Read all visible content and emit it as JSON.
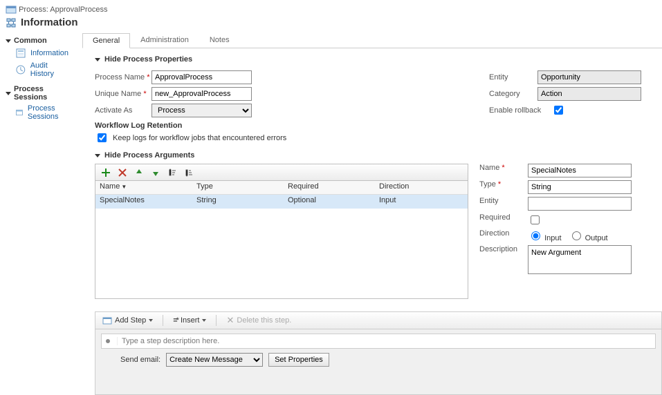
{
  "header": {
    "process_label": "Process: ApprovalProcess",
    "title": "Information"
  },
  "nav": {
    "common": {
      "label": "Common",
      "items": [
        {
          "label": "Information",
          "icon": "form-icon"
        },
        {
          "label": "Audit History",
          "icon": "history-icon"
        }
      ]
    },
    "sessions": {
      "label": "Process Sessions",
      "items": [
        {
          "label": "Process Sessions",
          "icon": "sessions-icon"
        }
      ]
    }
  },
  "tabs": {
    "general": "General",
    "administration": "Administration",
    "notes": "Notes"
  },
  "sections": {
    "properties": "Hide Process Properties",
    "arguments": "Hide Process Arguments"
  },
  "form": {
    "process_name": {
      "label": "Process Name",
      "value": "ApprovalProcess"
    },
    "unique_name": {
      "label": "Unique Name",
      "value": "new_ApprovalProcess"
    },
    "activate_as": {
      "label": "Activate As",
      "value": "Process"
    },
    "entity": {
      "label": "Entity",
      "value": "Opportunity"
    },
    "category": {
      "label": "Category",
      "value": "Action"
    },
    "enable_rollback": {
      "label": "Enable rollback",
      "checked": true
    },
    "wf_heading": "Workflow Log Retention",
    "wf_checkbox": {
      "label": "Keep logs for workflow jobs that encountered errors",
      "checked": true
    }
  },
  "args": {
    "columns": {
      "name": "Name",
      "type": "Type",
      "required": "Required",
      "direction": "Direction"
    },
    "rows": [
      {
        "name": "SpecialNotes",
        "type": "String",
        "required": "Optional",
        "direction": "Input"
      }
    ],
    "side": {
      "name": {
        "label": "Name",
        "value": "SpecialNotes"
      },
      "type": {
        "label": "Type",
        "value": "String"
      },
      "entity": {
        "label": "Entity",
        "value": ""
      },
      "required": {
        "label": "Required",
        "checked": false
      },
      "direction": {
        "label": "Direction",
        "input": "Input",
        "output": "Output",
        "selected": "Input"
      },
      "description": {
        "label": "Description",
        "value": "New Argument"
      }
    }
  },
  "steps_toolbar": {
    "add_step": "Add Step",
    "insert": "Insert",
    "delete": "Delete this step."
  },
  "steps": {
    "placeholder": "Type a step description here.",
    "row": {
      "label": "Send email:",
      "option": "Create New Message",
      "button": "Set Properties"
    }
  }
}
